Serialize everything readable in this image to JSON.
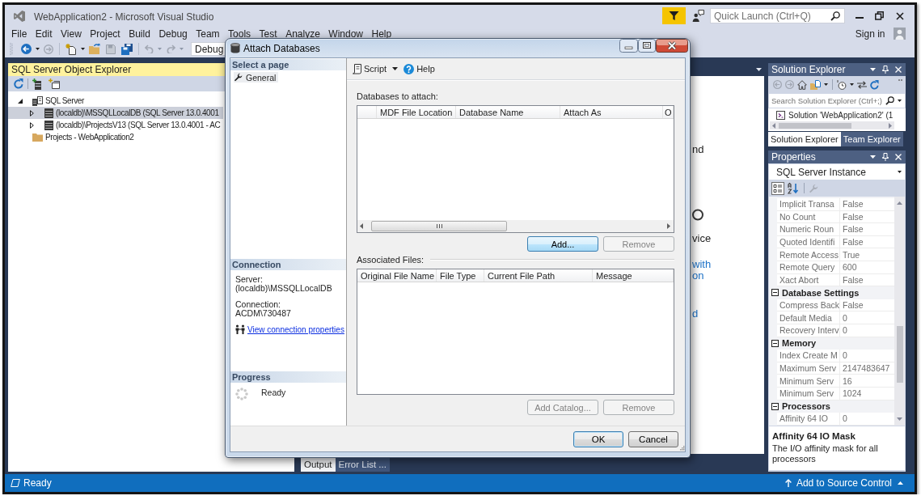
{
  "window": {
    "title": "WebApplication2 - Microsoft Visual Studio",
    "quick_launch": {
      "placeholder": "Quick Launch (Ctrl+Q)"
    },
    "sign_in": "Sign in"
  },
  "menu": [
    "File",
    "Edit",
    "View",
    "Project",
    "Build",
    "Debug",
    "Team",
    "Tools",
    "Test",
    "Analyze",
    "Window",
    "Help"
  ],
  "toolbar": {
    "configuration": "Debug"
  },
  "sql_server_object_explorer": {
    "title": "SQL Server Object Explorer",
    "active": true,
    "tree": [
      {
        "label": "SQL Server",
        "kind": "server-group",
        "expanded": true,
        "selected": false,
        "children": [
          {
            "label": "(localdb)\\MSSQLLocalDB (SQL Server 13.0.4001",
            "kind": "instance",
            "expanded": false,
            "selected": true
          },
          {
            "label": "(localdb)\\ProjectsV13 (SQL Server 13.0.4001 - AC",
            "kind": "instance",
            "expanded": false,
            "selected": false
          }
        ]
      },
      {
        "label": "Projects - WebApplication2",
        "kind": "folder",
        "selected": false
      }
    ]
  },
  "document": {
    "fragments": [
      {
        "text": "nd",
        "kind": "text"
      },
      {
        "text": "vice",
        "kind": "text"
      },
      {
        "text": "with",
        "kind": "link"
      },
      {
        "text": "on",
        "kind": "link"
      },
      {
        "text": "d",
        "kind": "link"
      }
    ],
    "tabs": [
      {
        "label": "Output",
        "selected": true
      },
      {
        "label": "Error List ...",
        "selected": false
      }
    ]
  },
  "solution_explorer": {
    "title": "Solution Explorer",
    "active": false,
    "search": {
      "placeholder": "Search Solution Explorer (Ctrl+;)"
    },
    "tree": [
      {
        "label": "Solution 'WebApplication2' (1"
      }
    ],
    "tabs": [
      {
        "label": "Solution Explorer",
        "selected": true
      },
      {
        "label": "Team Explorer",
        "selected": false
      }
    ]
  },
  "properties": {
    "title": "Properties",
    "active": false,
    "object": "SQL Server Instance",
    "views": [
      {
        "kind": "categorized",
        "selected": true
      },
      {
        "kind": "alphabetical",
        "selected": false
      }
    ],
    "rows": [
      {
        "name": "Implicit Transa",
        "value": "False"
      },
      {
        "name": "No Count",
        "value": "False"
      },
      {
        "name": "Numeric Roun",
        "value": "False"
      },
      {
        "name": "Quoted Identifi",
        "value": "False"
      },
      {
        "name": "Remote Access",
        "value": "True"
      },
      {
        "name": "Remote Query",
        "value": "600"
      },
      {
        "name": "Xact Abort",
        "value": "False"
      }
    ],
    "categories": [
      {
        "name": "Database Settings",
        "expanded": true,
        "rows": [
          {
            "name": "Compress Back",
            "value": "False"
          },
          {
            "name": "Default Media",
            "value": "0"
          },
          {
            "name": "Recovery Interv",
            "value": "0"
          }
        ]
      },
      {
        "name": "Memory",
        "expanded": true,
        "rows": [
          {
            "name": "Index Create M",
            "value": "0"
          },
          {
            "name": "Maximum Serv",
            "value": "2147483647"
          },
          {
            "name": "Minimum Serv",
            "value": "16"
          },
          {
            "name": "Minimum Serv",
            "value": "1024"
          }
        ]
      },
      {
        "name": "Processors",
        "expanded": true,
        "rows": [
          {
            "name": "Affinity 64 IO",
            "value": "0"
          }
        ]
      }
    ],
    "description": {
      "title": "Affinity 64 IO Mask",
      "text": "The I/O affinity mask for all processors"
    }
  },
  "dialog": {
    "title": "Attach Databases",
    "pages_header": "Select a page",
    "pages": [
      {
        "label": "General",
        "selected": true
      }
    ],
    "connection": {
      "header": "Connection",
      "server_label": "Server:",
      "server": "(localdb)\\MSSQLLocalDB",
      "connection_label": "Connection:",
      "connection": "ACDM\\730487",
      "link": "View connection properties"
    },
    "progress": {
      "header": "Progress",
      "status": "Ready"
    },
    "toolbar": {
      "script": "Script",
      "help": "Help"
    },
    "databases": {
      "label": "Databases to attach:",
      "columns": [
        "MDF File Location",
        "Database Name",
        "Attach As",
        "O"
      ],
      "buttons": [
        {
          "label": "Add...",
          "disabled": false,
          "highlighted": true
        },
        {
          "label": "Remove",
          "disabled": true,
          "highlighted": false
        }
      ]
    },
    "associated_files": {
      "label": "Associated Files:",
      "columns": [
        "Original File Name",
        "File Type",
        "Current File Path",
        "Message"
      ],
      "buttons": [
        {
          "label": "Add Catalog...",
          "disabled": true
        },
        {
          "label": "Remove",
          "disabled": true
        }
      ]
    },
    "buttons": [
      {
        "label": "OK",
        "default": true
      },
      {
        "label": "Cancel",
        "default": false
      }
    ]
  },
  "status_bar": {
    "text": "Ready",
    "source_control": "Add to Source Control"
  }
}
